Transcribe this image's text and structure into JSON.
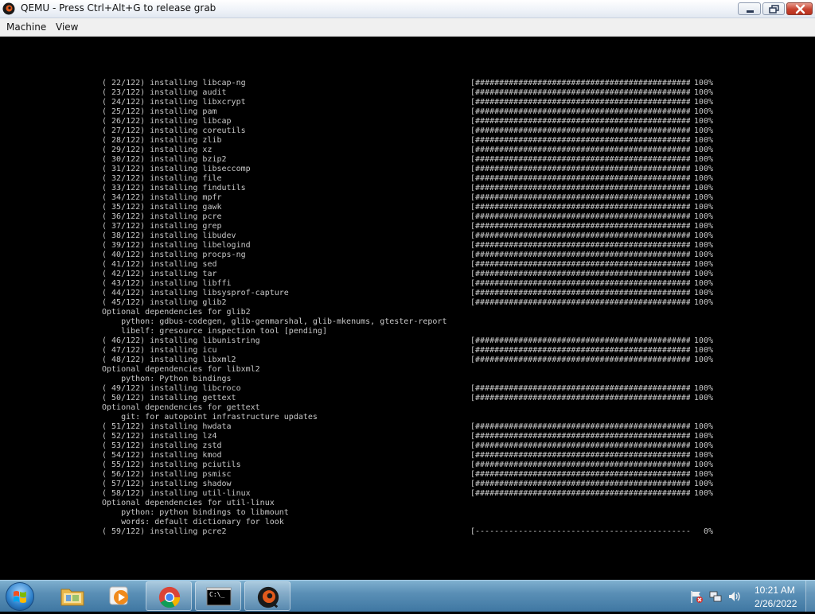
{
  "window": {
    "title": "QEMU - Press Ctrl+Alt+G to release grab",
    "menu": [
      "Machine",
      "View"
    ]
  },
  "console": {
    "lines": [
      {
        "text": "( 22/122) installing libcap-ng",
        "bar": "[#############################################]",
        "pct": "100%"
      },
      {
        "text": "( 23/122) installing audit",
        "bar": "[#############################################]",
        "pct": "100%"
      },
      {
        "text": "( 24/122) installing libxcrypt",
        "bar": "[#############################################]",
        "pct": "100%"
      },
      {
        "text": "( 25/122) installing pam",
        "bar": "[#############################################]",
        "pct": "100%"
      },
      {
        "text": "( 26/122) installing libcap",
        "bar": "[#############################################]",
        "pct": "100%"
      },
      {
        "text": "( 27/122) installing coreutils",
        "bar": "[#############################################]",
        "pct": "100%"
      },
      {
        "text": "( 28/122) installing zlib",
        "bar": "[#############################################]",
        "pct": "100%"
      },
      {
        "text": "( 29/122) installing xz",
        "bar": "[#############################################]",
        "pct": "100%"
      },
      {
        "text": "( 30/122) installing bzip2",
        "bar": "[#############################################]",
        "pct": "100%"
      },
      {
        "text": "( 31/122) installing libseccomp",
        "bar": "[#############################################]",
        "pct": "100%"
      },
      {
        "text": "( 32/122) installing file",
        "bar": "[#############################################]",
        "pct": "100%"
      },
      {
        "text": "( 33/122) installing findutils",
        "bar": "[#############################################]",
        "pct": "100%"
      },
      {
        "text": "( 34/122) installing mpfr",
        "bar": "[#############################################]",
        "pct": "100%"
      },
      {
        "text": "( 35/122) installing gawk",
        "bar": "[#############################################]",
        "pct": "100%"
      },
      {
        "text": "( 36/122) installing pcre",
        "bar": "[#############################################]",
        "pct": "100%"
      },
      {
        "text": "( 37/122) installing grep",
        "bar": "[#############################################]",
        "pct": "100%"
      },
      {
        "text": "( 38/122) installing libudev",
        "bar": "[#############################################]",
        "pct": "100%"
      },
      {
        "text": "( 39/122) installing libelogind",
        "bar": "[#############################################]",
        "pct": "100%"
      },
      {
        "text": "( 40/122) installing procps-ng",
        "bar": "[#############################################]",
        "pct": "100%"
      },
      {
        "text": "( 41/122) installing sed",
        "bar": "[#############################################]",
        "pct": "100%"
      },
      {
        "text": "( 42/122) installing tar",
        "bar": "[#############################################]",
        "pct": "100%"
      },
      {
        "text": "( 43/122) installing libffi",
        "bar": "[#############################################]",
        "pct": "100%"
      },
      {
        "text": "( 44/122) installing libsysprof-capture",
        "bar": "[#############################################]",
        "pct": "100%"
      },
      {
        "text": "( 45/122) installing glib2",
        "bar": "[#############################################]",
        "pct": "100%"
      },
      {
        "text": "Optional dependencies for glib2",
        "bar": "",
        "pct": ""
      },
      {
        "text": "    python: gdbus-codegen, glib-genmarshal, glib-mkenums, gtester-report",
        "bar": "",
        "pct": ""
      },
      {
        "text": "    libelf: gresource inspection tool [pending]",
        "bar": "",
        "pct": ""
      },
      {
        "text": "( 46/122) installing libunistring",
        "bar": "[#############################################]",
        "pct": "100%"
      },
      {
        "text": "( 47/122) installing icu",
        "bar": "[#############################################]",
        "pct": "100%"
      },
      {
        "text": "( 48/122) installing libxml2",
        "bar": "[#############################################]",
        "pct": "100%"
      },
      {
        "text": "Optional dependencies for libxml2",
        "bar": "",
        "pct": ""
      },
      {
        "text": "    python: Python bindings",
        "bar": "",
        "pct": ""
      },
      {
        "text": "( 49/122) installing libcroco",
        "bar": "[#############################################]",
        "pct": "100%"
      },
      {
        "text": "( 50/122) installing gettext",
        "bar": "[#############################################]",
        "pct": "100%"
      },
      {
        "text": "Optional dependencies for gettext",
        "bar": "",
        "pct": ""
      },
      {
        "text": "    git: for autopoint infrastructure updates",
        "bar": "",
        "pct": ""
      },
      {
        "text": "( 51/122) installing hwdata",
        "bar": "[#############################################]",
        "pct": "100%"
      },
      {
        "text": "( 52/122) installing lz4",
        "bar": "[#############################################]",
        "pct": "100%"
      },
      {
        "text": "( 53/122) installing zstd",
        "bar": "[#############################################]",
        "pct": "100%"
      },
      {
        "text": "( 54/122) installing kmod",
        "bar": "[#############################################]",
        "pct": "100%"
      },
      {
        "text": "( 55/122) installing pciutils",
        "bar": "[#############################################]",
        "pct": "100%"
      },
      {
        "text": "( 56/122) installing psmisc",
        "bar": "[#############################################]",
        "pct": "100%"
      },
      {
        "text": "( 57/122) installing shadow",
        "bar": "[#############################################]",
        "pct": "100%"
      },
      {
        "text": "( 58/122) installing util-linux",
        "bar": "[#############################################]",
        "pct": "100%"
      },
      {
        "text": "Optional dependencies for util-linux",
        "bar": "",
        "pct": ""
      },
      {
        "text": "    python: python bindings to libmount",
        "bar": "",
        "pct": ""
      },
      {
        "text": "    words: default dictionary for look",
        "bar": "",
        "pct": ""
      },
      {
        "text": "( 59/122) installing pcre2",
        "bar": "[---------------------------------------------]",
        "pct": "0%"
      }
    ]
  },
  "taskbar": {
    "items": [
      "start",
      "explorer",
      "media-player",
      "chrome",
      "terminal",
      "qemu"
    ],
    "terminal_label": "C:\\_",
    "clock": {
      "time": "10:21 AM",
      "date": "2/26/2022"
    }
  }
}
